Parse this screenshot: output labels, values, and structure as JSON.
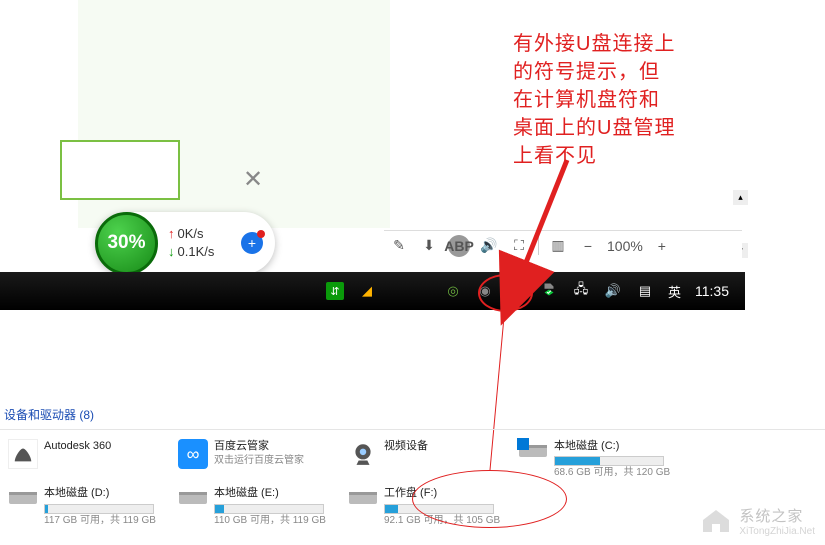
{
  "annotation": {
    "line1": "有外接U盘连接上",
    "line2": "的符号提示，但",
    "line3": "在计算机盘符和",
    "line4": "桌面上的U盘管理",
    "line5": "上看不见"
  },
  "status": {
    "percent": "30%",
    "upload": "0K/s",
    "download": "0.1K/s"
  },
  "toolbar": {
    "zoom": "100%",
    "minus": "−",
    "plus": "+"
  },
  "taskbar": {
    "ime": "英",
    "time": "11:35"
  },
  "explorer": {
    "section_label": "设备和驱动器 (8)",
    "autodesk": {
      "title": "Autodesk 360"
    },
    "baidu": {
      "title": "百度云管家",
      "sub": "双击运行百度云管家"
    },
    "webcam": {
      "title": "视频设备"
    },
    "c": {
      "title": "本地磁盘 (C:)",
      "sub": "68.6 GB 可用，共 120 GB",
      "fill": 42
    },
    "d": {
      "title": "本地磁盘 (D:)",
      "sub": "117 GB 可用，共 119 GB",
      "fill": 3
    },
    "e": {
      "title": "本地磁盘 (E:)",
      "sub": "110 GB 可用，共 119 GB",
      "fill": 8
    },
    "f": {
      "title": "工作盘 (F:)",
      "sub": "92.1 GB 可用，共 105 GB",
      "fill": 12
    }
  },
  "watermark": {
    "text": "系统之家",
    "url": "XiTongZhiJia.Net"
  }
}
